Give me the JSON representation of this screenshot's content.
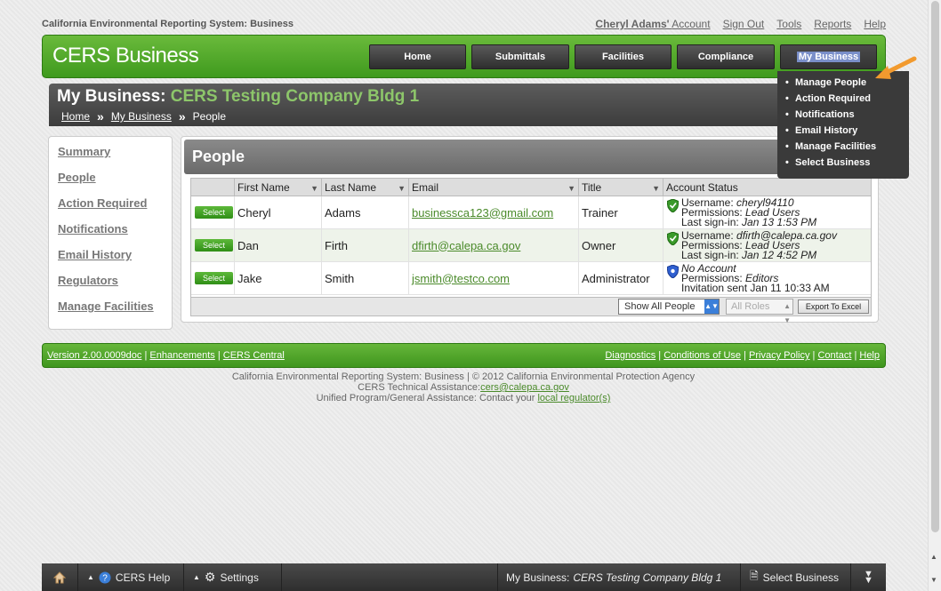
{
  "app_title": "California Environmental Reporting System: Business",
  "top_links": {
    "account_name": "Cheryl Adams'",
    "account_label": "Account",
    "sign_out": "Sign Out",
    "tools": "Tools",
    "reports": "Reports",
    "help": "Help"
  },
  "brand": "CERS Business",
  "nav": [
    "Home",
    "Submittals",
    "Facilities",
    "Compliance",
    "My Business"
  ],
  "dropdown": [
    "Manage People",
    "Action Required",
    "Notifications",
    "Email History",
    "Manage Facilities",
    "Select Business"
  ],
  "page_title": {
    "prefix": "My Business:",
    "business": "CERS Testing Company Bldg 1"
  },
  "breadcrumb": {
    "home": "Home",
    "my_business": "My Business",
    "current": "People",
    "sep": "»"
  },
  "sidebar": [
    "Summary",
    "People",
    "Action Required",
    "Notifications",
    "Email History",
    "Regulators",
    "Manage Facilities"
  ],
  "panel_title": "People",
  "columns": [
    "",
    "First Name",
    "Last Name",
    "Email",
    "Title",
    "Account Status"
  ],
  "select_label": "Select",
  "rows": [
    {
      "first": "Cheryl",
      "last": "Adams",
      "email": "businessca123@gmail.com",
      "title": "Trainer",
      "status": {
        "line1_label": "Username:",
        "line1_value": "cheryl94110",
        "line2_label": "Permissions:",
        "line2_value": "Lead Users",
        "line3_label": "Last sign-in:",
        "line3_value": "Jan 13 1:53 PM"
      }
    },
    {
      "first": "Dan",
      "last": "Firth",
      "email": "dfirth@calepa.ca.gov",
      "title": "Owner",
      "status": {
        "line1_label": "Username:",
        "line1_value": "dfirth@calepa.ca.gov",
        "line2_label": "Permissions:",
        "line2_value": "Lead Users",
        "line3_label": "Last sign-in:",
        "line3_value": "Jan 12 4:52 PM"
      }
    },
    {
      "first": "Jake",
      "last": "Smith",
      "email": "jsmith@testco.com",
      "title": "Administrator",
      "status": {
        "line1_label": "",
        "line1_value": "No Account",
        "line2_label": "Permissions:",
        "line2_value": "Editors",
        "line3_label": "Invitation sent",
        "line3_value": "Jan 11 10:33 AM"
      }
    }
  ],
  "grid_footer": {
    "show_all": "Show All People",
    "roles": "All Roles",
    "export": "Export To Excel"
  },
  "footer_left": [
    "Version 2.00.0009doc",
    "Enhancements",
    "CERS Central"
  ],
  "footer_right": [
    "Diagnostics",
    "Conditions of Use",
    "Privacy Policy",
    "Contact",
    "Help"
  ],
  "copyright": {
    "line1": "California Environmental Reporting System: Business | © 2012 California Environmental Protection Agency",
    "line2_prefix": "CERS Technical Assistance:",
    "line2_link": "cers@calepa.ca.gov",
    "line3_prefix": "Unified Program/General Assistance: Contact your",
    "line3_link": "local regulator(s)"
  },
  "bottom_bar": {
    "help": "CERS Help",
    "settings": "Settings",
    "biz_label": "My Business:",
    "biz_name": "CERS Testing Company Bldg 1",
    "select_business": "Select Business"
  },
  "colors": {
    "green": "#3f9a1e",
    "dark": "#3a3a3a",
    "accent": "#f29a2e"
  },
  "icons": [
    "home-icon",
    "help-circle-icon",
    "gear-icon",
    "shield-green-icon",
    "shield-blue-icon",
    "document-icon",
    "double-chevron-down-icon",
    "filter-icon"
  ]
}
